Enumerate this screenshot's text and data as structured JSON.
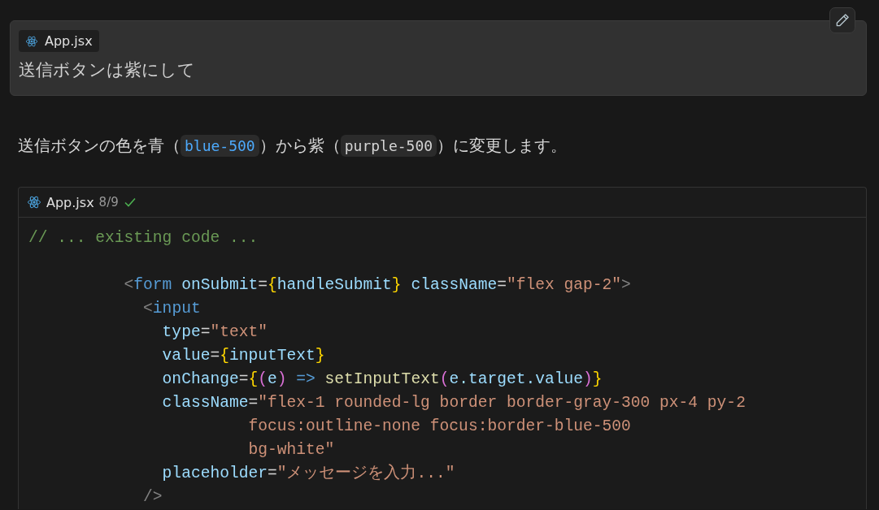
{
  "prompt": {
    "file_chip": "App.jsx",
    "text": "送信ボタンは紫にして"
  },
  "response": {
    "segments": [
      {
        "kind": "text",
        "text": "送信ボタンの色を青（"
      },
      {
        "kind": "code",
        "text": "blue-500",
        "color": "#4daafc"
      },
      {
        "kind": "text",
        "text": "）から紫（"
      },
      {
        "kind": "code",
        "text": "purple-500",
        "color": "#d4d4d4"
      },
      {
        "kind": "text",
        "text": "）に変更します。"
      }
    ]
  },
  "code_block": {
    "file": "App.jsx",
    "progress": "8/9",
    "done": true,
    "lines": [
      {
        "kind": "code",
        "tokens": [
          {
            "kind": "comment",
            "text": "// ... existing code ..."
          }
        ]
      },
      {
        "kind": "blank"
      },
      {
        "kind": "code",
        "tokens": [
          {
            "kind": "punct",
            "text": "          <"
          },
          {
            "kind": "tag",
            "text": "form"
          },
          {
            "kind": "attr",
            "text": " onSubmit"
          },
          {
            "kind": "plain",
            "text": "="
          },
          {
            "kind": "brace",
            "text": "{"
          },
          {
            "kind": "attr",
            "text": "handleSubmit"
          },
          {
            "kind": "brace",
            "text": "}"
          },
          {
            "kind": "attr",
            "text": " className"
          },
          {
            "kind": "plain",
            "text": "="
          },
          {
            "kind": "string",
            "text": "\"flex gap-2\""
          },
          {
            "kind": "punct",
            "text": ">"
          }
        ]
      },
      {
        "kind": "code",
        "tokens": [
          {
            "kind": "punct",
            "text": "            <"
          },
          {
            "kind": "tag",
            "text": "input"
          }
        ]
      },
      {
        "kind": "code",
        "tokens": [
          {
            "kind": "attr",
            "text": "              type"
          },
          {
            "kind": "plain",
            "text": "="
          },
          {
            "kind": "string",
            "text": "\"text\""
          }
        ]
      },
      {
        "kind": "code",
        "tokens": [
          {
            "kind": "attr",
            "text": "              value"
          },
          {
            "kind": "plain",
            "text": "="
          },
          {
            "kind": "brace",
            "text": "{"
          },
          {
            "kind": "attr",
            "text": "inputText"
          },
          {
            "kind": "brace",
            "text": "}"
          }
        ]
      },
      {
        "kind": "code",
        "tokens": [
          {
            "kind": "attr",
            "text": "              onChange"
          },
          {
            "kind": "plain",
            "text": "="
          },
          {
            "kind": "brace",
            "text": "{"
          },
          {
            "kind": "paren",
            "text": "("
          },
          {
            "kind": "attr",
            "text": "e"
          },
          {
            "kind": "paren",
            "text": ")"
          },
          {
            "kind": "tag",
            "text": " =>"
          },
          {
            "kind": "func",
            "text": " setInputText"
          },
          {
            "kind": "paren",
            "text": "("
          },
          {
            "kind": "attr",
            "text": "e.target.value"
          },
          {
            "kind": "paren",
            "text": ")"
          },
          {
            "kind": "brace",
            "text": "}"
          }
        ]
      },
      {
        "kind": "code",
        "tokens": [
          {
            "kind": "attr",
            "text": "              className"
          },
          {
            "kind": "plain",
            "text": "="
          },
          {
            "kind": "string",
            "text": "\"flex-1 rounded-lg border border-gray-300 px-4 py-2"
          }
        ]
      },
      {
        "kind": "code",
        "tokens": [
          {
            "kind": "string",
            "text": "                       focus:outline-none focus:border-blue-500"
          }
        ]
      },
      {
        "kind": "code",
        "tokens": [
          {
            "kind": "string",
            "text": "                       bg-white\""
          }
        ]
      },
      {
        "kind": "code",
        "tokens": [
          {
            "kind": "attr",
            "text": "              placeholder"
          },
          {
            "kind": "plain",
            "text": "="
          },
          {
            "kind": "string",
            "text": "\"メッセージを入力...\""
          }
        ]
      },
      {
        "kind": "code",
        "tokens": [
          {
            "kind": "punct",
            "text": "            />"
          }
        ]
      }
    ]
  }
}
